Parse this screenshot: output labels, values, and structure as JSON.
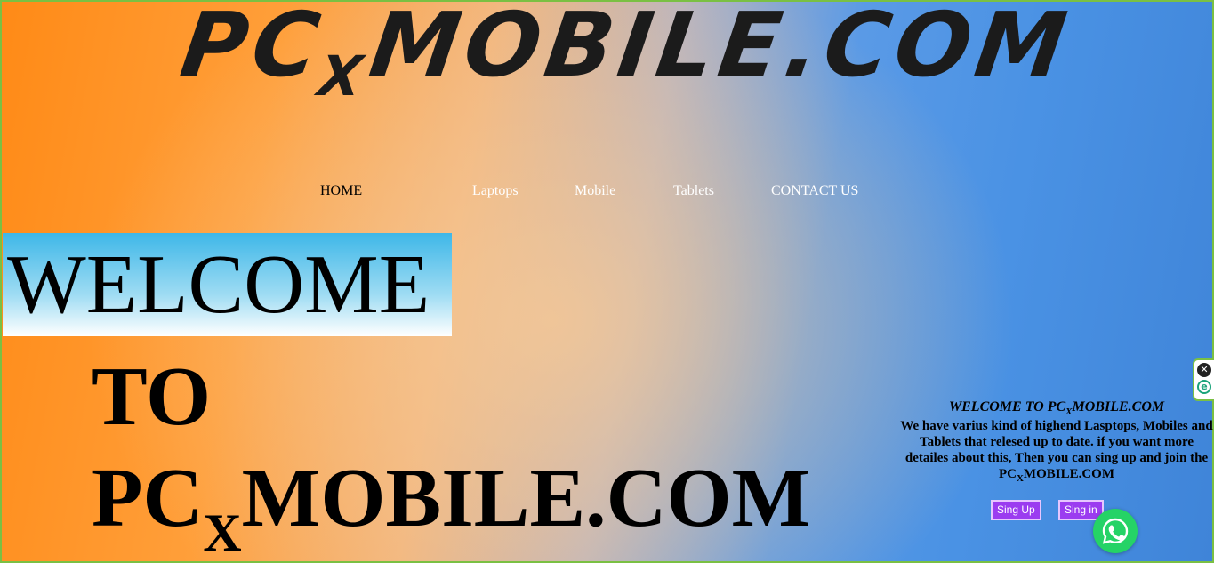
{
  "logo": {
    "prefix": "PC",
    "sub": "X",
    "suffix": "MOBILE.COM"
  },
  "nav": {
    "home": "HOME",
    "laptops": "Laptops",
    "mobile": "Mobile",
    "tablets": "Tablets",
    "contact": "CONTACT US"
  },
  "hero": {
    "welcome": "WELCOME",
    "to": "TO",
    "brand_prefix": "PC",
    "brand_sub": "X",
    "brand_suffix": "MOBILE.COM"
  },
  "info": {
    "title_prefix": "WELCOME TO PC",
    "title_sub": "X",
    "title_suffix": "MOBILE.COM",
    "body_main": "We have varius kind of highend Lasptops, Mobiles and Tablets that relesed up to date. if you want more detailes about this, Then you can sing up and join the PC",
    "body_sub": "X",
    "body_suffix": "MOBILE.COM"
  },
  "buttons": {
    "signup": "Sing Up",
    "signin": "Sing in"
  },
  "icons": {
    "close": "close-icon",
    "extension": "e-icon",
    "whatsapp": "whatsapp-icon"
  },
  "colors": {
    "button_bg": "#9b3cf0",
    "whatsapp": "#25d366",
    "welcome_highlight": "#3eb7e8"
  }
}
